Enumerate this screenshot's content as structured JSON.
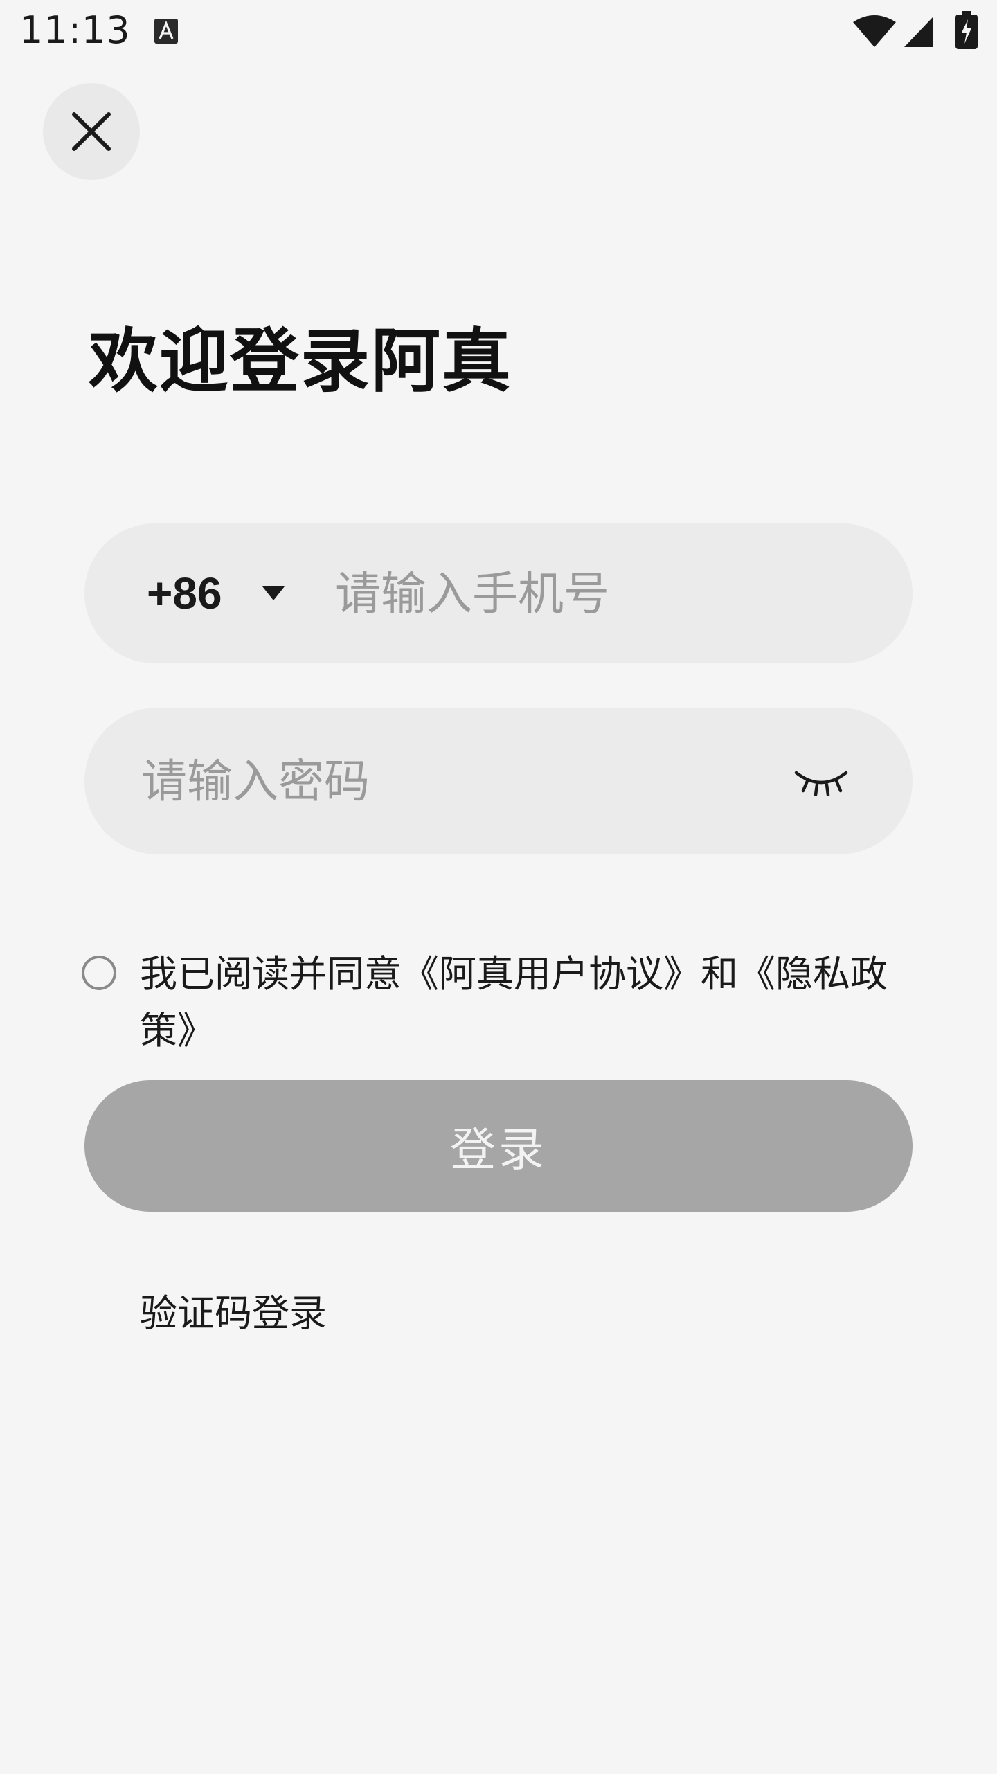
{
  "status_bar": {
    "time": "11:13",
    "icons": [
      "a-icon",
      "wifi-icon",
      "signal-icon",
      "battery-charging-icon"
    ]
  },
  "close_button": {
    "icon": "close-icon"
  },
  "title": "欢迎登录阿真",
  "phone": {
    "country_code": "+86",
    "chevron_icon": "chevron-down-icon",
    "placeholder": "请输入手机号",
    "value": ""
  },
  "password": {
    "placeholder": "请输入密码",
    "value": "",
    "toggle_icon": "eye-closed-icon"
  },
  "agreement": {
    "checked": false,
    "prefix": "我已阅读并同意",
    "user_agreement": "《阿真用户协议》",
    "conjunction": "和",
    "privacy_policy": "《隐私政策》"
  },
  "login_button": {
    "label": "登录",
    "enabled": false,
    "color": "#a6a6a6"
  },
  "alt_login": {
    "label": "验证码登录"
  },
  "colors": {
    "background": "#f5f5f5",
    "input_background": "#ebebeb",
    "disabled_button": "#a6a6a6"
  }
}
